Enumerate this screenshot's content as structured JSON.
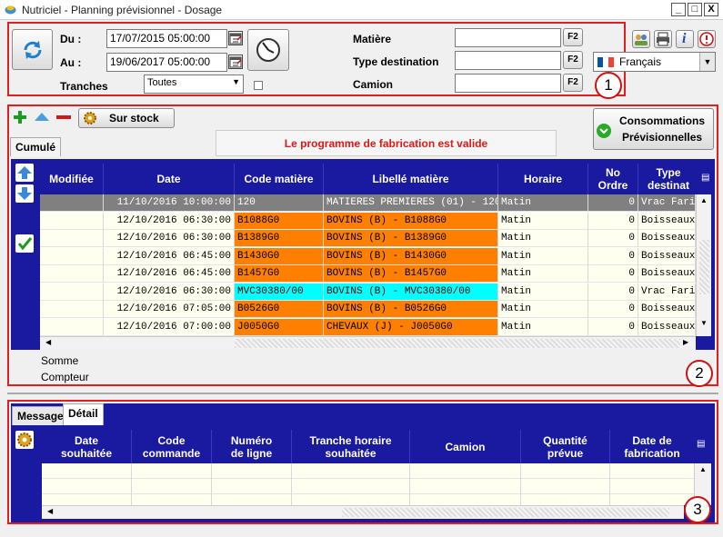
{
  "window": {
    "title": "Nutriciel - Planning prévisionnel  - Dosage",
    "controls": [
      "_",
      "□",
      "X"
    ]
  },
  "filters": {
    "du_label": "Du :",
    "du_value": "17/07/2015 05:00:00",
    "au_label": "Au :",
    "au_value": "19/06/2017 05:00:00",
    "tranches_label": "Tranches",
    "tranches_value": "Toutes",
    "matiere_label": "Matière",
    "type_destination_label": "Type destination",
    "camion_label": "Camion",
    "f2_label": "F2",
    "language_value": "Français"
  },
  "callouts": {
    "one": "1",
    "two": "2",
    "three": "3"
  },
  "toolbar": {
    "sur_stock_label": "Sur stock",
    "consommations_line1": "Consommations",
    "consommations_line2": "Prévisionnelles"
  },
  "top_tabs": {
    "cumule": "Cumulé"
  },
  "status_message": "Le programme de fabrication est valide",
  "colors": {
    "accent_blue": "#1a1aa0",
    "orange": "#ff8000",
    "cyan": "#00ffff",
    "status_red": "#e02020",
    "selected_gray": "#808080"
  },
  "main_grid": {
    "headers": {
      "modifiee": "Modifiée",
      "date": "Date",
      "code_matiere": "Code matière",
      "libelle_matiere": "Libellé matière",
      "horaire": "Horaire",
      "no_ordre_1": "No",
      "no_ordre_2": "Ordre",
      "type_dest_1": "Type",
      "type_dest_2": "destinat"
    },
    "rows": [
      {
        "date": "11/10/2016 10:00:00",
        "code": "120",
        "libelle": "MATIERES PREMIERES (01) - 120",
        "horaire": "Matin",
        "ordre": "0",
        "type": "Vrac Farine",
        "style": "selected"
      },
      {
        "date": "12/10/2016 06:30:00",
        "code": "B1088G0",
        "libelle": "BOVINS (B) - B1088G0",
        "horaire": "Matin",
        "ordre": "0",
        "type": "Boisseaux",
        "style": "orange"
      },
      {
        "date": "12/10/2016 06:30:00",
        "code": "B1389G0",
        "libelle": "BOVINS (B) - B1389G0",
        "horaire": "Matin",
        "ordre": "0",
        "type": "Boisseaux",
        "style": "orange"
      },
      {
        "date": "12/10/2016 06:45:00",
        "code": "B1430G0",
        "libelle": "BOVINS (B) - B1430G0",
        "horaire": "Matin",
        "ordre": "0",
        "type": "Boisseaux",
        "style": "orange"
      },
      {
        "date": "12/10/2016 06:45:00",
        "code": "B1457G0",
        "libelle": "BOVINS (B) - B1457G0",
        "horaire": "Matin",
        "ordre": "0",
        "type": "Boisseaux",
        "style": "orange"
      },
      {
        "date": "12/10/2016 06:30:00",
        "code": "MVC30380/00",
        "libelle": "BOVINS (B) - MVC30380/00",
        "horaire": "Matin",
        "ordre": "0",
        "type": "Vrac Farine",
        "style": "cyan"
      },
      {
        "date": "12/10/2016 07:05:00",
        "code": "B0526G0",
        "libelle": "BOVINS (B) - B0526G0",
        "horaire": "Matin",
        "ordre": "0",
        "type": "Boisseaux",
        "style": "orange"
      },
      {
        "date": "12/10/2016 07:00:00",
        "code": "J0050G0",
        "libelle": "CHEVAUX (J) - J0050G0",
        "horaire": "Matin",
        "ordre": "0",
        "type": "Boisseaux",
        "style": "orange"
      }
    ],
    "footer_somme": "Somme",
    "footer_compteur": "Compteur"
  },
  "bottom_tabs": {
    "message": "Message",
    "detail": "Détail"
  },
  "detail_grid": {
    "headers": {
      "date_souhaitee_1": "Date",
      "date_souhaitee_2": "souhaitée",
      "code_commande_1": "Code",
      "code_commande_2": "commande",
      "numero_ligne_1": "Numéro",
      "numero_ligne_2": "de ligne",
      "tranche_1": "Tranche horaire",
      "tranche_2": "souhaitée",
      "camion": "Camion",
      "quantite_1": "Quantité",
      "quantite_2": "prévue",
      "date_fab_1": "Date de",
      "date_fab_2": "fabrication"
    }
  }
}
